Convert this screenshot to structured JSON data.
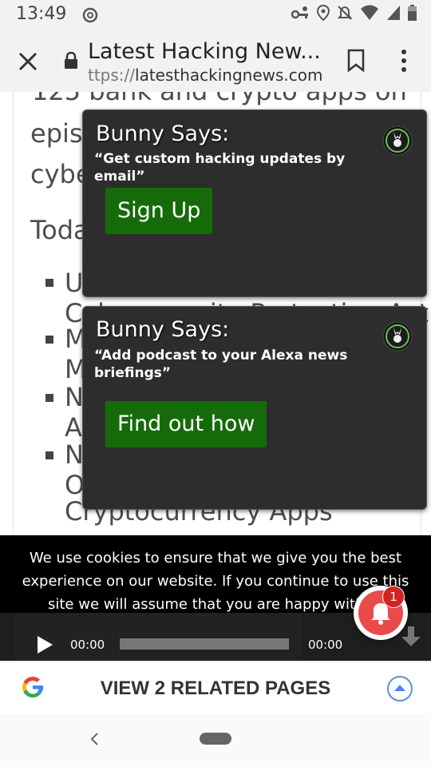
{
  "status_bar": {
    "time": "13:49",
    "icons": [
      "data-saver-icon",
      "vpn-key-icon",
      "location-icon",
      "mute-icon",
      "wifi-icon",
      "signal-icon",
      "battery-icon"
    ]
  },
  "toolbar": {
    "title": "Latest Hacking New...",
    "url_muted": "ttps://",
    "url_host": "latesthackingnews.com",
    "icons": [
      "close-icon",
      "lock-icon",
      "bookmark-icon",
      "more-vert-icon"
    ]
  },
  "article": {
    "line1": "125 bank and crypto apps on",
    "line2": "episo",
    "line3": "cybe",
    "line4": "Toda",
    "list": [
      {
        "l1": "U",
        "l2": "Cybersecurity Protection Act"
      },
      {
        "l1": "M",
        "l2": "M"
      },
      {
        "l1": "N",
        "l2": "Ar"
      },
      {
        "l1": "N",
        "l2": "O",
        "l3": "Cryptocurrency Apps"
      }
    ]
  },
  "popups": [
    {
      "title": "Bunny Says:",
      "text": "“Get custom hacking updates by email”",
      "button": "Sign Up"
    },
    {
      "title": "Bunny Says:",
      "text": "“Add podcast to your Alexa news briefings”",
      "button": "Find out how"
    }
  ],
  "cookie_notice": {
    "text": "We use cookies to ensure that we give you the best experience on our website. If you continue to use this site we will assume that you are happy with it."
  },
  "player": {
    "time_current": "00:00",
    "time_total": "00:00",
    "progress": 0
  },
  "notification_bell": {
    "badge_count": "1",
    "color": "#e94b4b"
  },
  "related": {
    "label": "VIEW 2 RELATED PAGES"
  },
  "colors": {
    "popup_button": "#156b09",
    "popup_bg": "#2d2d2d",
    "cookie_bg": "#000000"
  }
}
